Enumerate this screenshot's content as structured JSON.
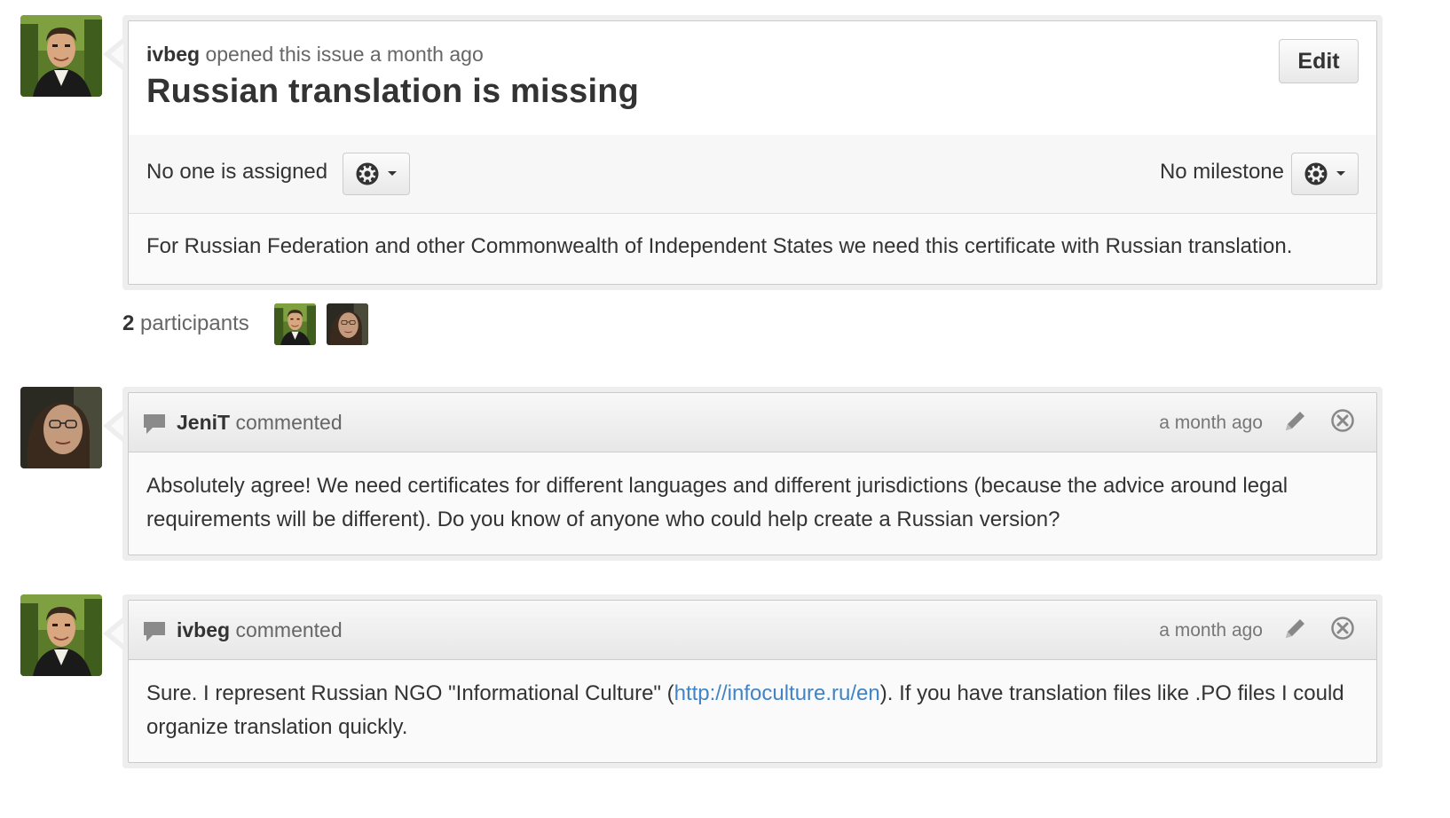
{
  "issue": {
    "author": "ivbeg",
    "meta": "opened this issue a month ago",
    "title": "Russian translation is missing",
    "edit_label": "Edit",
    "assignee": "No one is assigned",
    "milestone": "No milestone",
    "body": "For Russian Federation and other Commonwealth of Independent States we need this certificate with Russian translation."
  },
  "participants": {
    "count": "2",
    "label": "participants"
  },
  "comments": [
    {
      "author": "JeniT",
      "action": "commented",
      "time": "a month ago",
      "body": "Absolutely agree! We need certificates for different languages and different jurisdictions (because the advice around legal requirements will be different). Do you know of anyone who could help create a Russian version?"
    },
    {
      "author": "ivbeg",
      "action": "commented",
      "time": "a month ago",
      "body_before": "Sure. I represent Russian NGO \"Informational Culture\" (",
      "link": "http://infoculture.ru/en",
      "body_after": "). If you have translation files like .PO files I could organize translation quickly."
    }
  ],
  "icons": {
    "settings": "gear-icon",
    "dropdown": "caret-down-icon",
    "comment": "speech-bubble-icon",
    "edit": "pencil-icon",
    "delete": "close-circle-icon"
  },
  "colors": {
    "link": "#4183c4",
    "text": "#333333",
    "muted": "#666666"
  }
}
